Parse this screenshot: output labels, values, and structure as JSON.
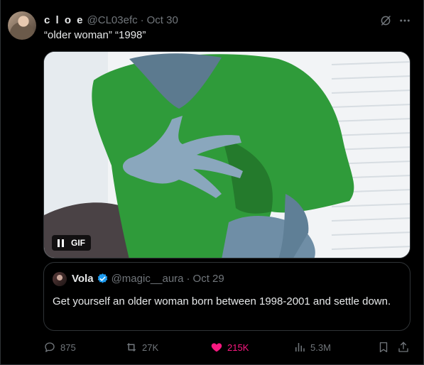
{
  "tweet": {
    "author_name": "c l o e",
    "author_handle": "@CL03efc",
    "separator": "·",
    "date": "Oct 30",
    "text": "“older woman” “1998”",
    "media": {
      "type": "gif",
      "badge": "GIF",
      "state": "paused-control-visible"
    }
  },
  "quote": {
    "author_name": "Vola",
    "author_handle": "@magic__aura",
    "separator": "·",
    "date": "Oct 29",
    "verified": true,
    "text": "Get yourself an older woman born between 1998-2001 and settle down."
  },
  "actions": {
    "replies": "875",
    "retweets": "27K",
    "likes": "215K",
    "views": "5.3M",
    "liked": true
  },
  "colors": {
    "background": "#000000",
    "text_primary": "#e7e9ea",
    "text_secondary": "#71767b",
    "like": "#f91880",
    "verified": "#1d9bf0",
    "border": "#2f3336"
  },
  "icons": [
    "grok-icon",
    "more-icon",
    "pause-icon",
    "verified-icon",
    "reply-icon",
    "retweet-icon",
    "heart-icon",
    "views-icon",
    "bookmark-icon",
    "share-icon"
  ]
}
